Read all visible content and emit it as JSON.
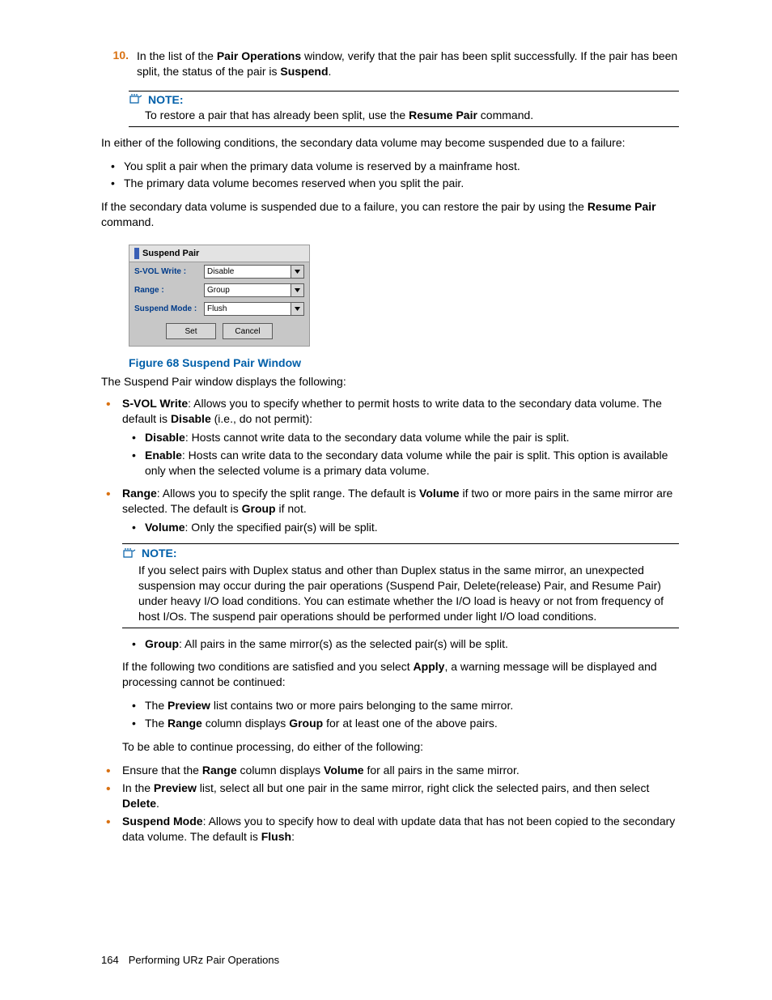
{
  "step": {
    "num": "10.",
    "text_a": "In the list of the ",
    "bold_a": "Pair Operations",
    "text_b": " window, verify that the pair has been split successfully. If the pair has been split, the status of the pair is ",
    "bold_b": "Suspend",
    "text_c": "."
  },
  "note1": {
    "label": "NOTE:",
    "body_a": "To restore a pair that has already been split, use the ",
    "body_bold": "Resume Pair",
    "body_b": " command."
  },
  "after_note1_para": "In either of the following conditions, the secondary data volume may become suspended due to a failure:",
  "after_note1_bullets": [
    "You split a pair when the primary data volume is reserved by a mainframe host.",
    "The primary data volume becomes reserved when you split the pair."
  ],
  "after_note1_para2_a": "If the secondary data volume is suspended due to a failure, you can restore the pair by using the ",
  "after_note1_para2_bold": "Resume Pair",
  "after_note1_para2_b": " command.",
  "dialog": {
    "title": "Suspend Pair",
    "rows": [
      {
        "label": "S-VOL Write :",
        "value": "Disable"
      },
      {
        "label": "Range :",
        "value": "Group"
      },
      {
        "label": "Suspend Mode :",
        "value": "Flush"
      }
    ],
    "set": "Set",
    "cancel": "Cancel"
  },
  "figure_caption": "Figure 68 Suspend Pair Window",
  "desc_intro": "The Suspend Pair window displays the following:",
  "svol": {
    "lead_bold": "S-VOL Write",
    "lead_rest": ": Allows you to specify whether to permit hosts to write data to the secondary data volume. The default is ",
    "lead_bold2": "Disable",
    "lead_rest2": " (i.e., do not permit):",
    "sub": [
      {
        "b": "Disable",
        "t": ": Hosts cannot write data to the secondary data volume while the pair is split."
      },
      {
        "b": "Enable",
        "t": ": Hosts can write data to the secondary data volume while the pair is split. This option is available only when the selected volume is a primary data volume."
      }
    ]
  },
  "range": {
    "lead_bold": "Range",
    "lead_a": ": Allows you to specify the split range. The default is ",
    "lead_b_bold": "Volume",
    "lead_b": " if two or more pairs in the same mirror are selected. The default is ",
    "lead_c_bold": "Group",
    "lead_c": " if not.",
    "sub_volume_b": "Volume",
    "sub_volume_t": ": Only the specified pair(s) will be split."
  },
  "note2": {
    "label": "NOTE:",
    "body": "If you select pairs with Duplex status and other than Duplex status in the same mirror, an unexpected suspension may occur during the pair operations (Suspend Pair, Delete(release) Pair, and Resume Pair) under heavy I/O load conditions. You can estimate whether the I/O load is heavy or not from frequency of host I/Os. The suspend pair operations should be performed under light I/O load conditions."
  },
  "group_sub_b": "Group",
  "group_sub_t": ": All pairs in the same mirror(s) as the selected pair(s) will be split.",
  "apply_para_a": "If the following two conditions are satisfied and you select ",
  "apply_para_bold": "Apply",
  "apply_para_b": ", a warning message will be displayed and processing cannot be continued:",
  "cond_bullets": [
    {
      "a": "The ",
      "b": "Preview",
      "c": " list contains two or more pairs belonging to the same mirror."
    },
    {
      "a": "The ",
      "b": "Range",
      "c": " column displays ",
      "d": "Group",
      "e": " for at least one of the above pairs."
    }
  ],
  "continue_para": "To be able to continue processing, do either of the following:",
  "continue_bullets": [
    {
      "a": "Ensure that the ",
      "b": "Range",
      "c": " column displays ",
      "d": "Volume",
      "e": " for all pairs in the same mirror."
    },
    {
      "a": "In the ",
      "b": "Preview",
      "c": " list, select all but one pair in the same mirror, right click the selected pairs, and then select ",
      "d": "Delete",
      "e": "."
    }
  ],
  "suspend_mode": {
    "b": "Suspend Mode",
    "a": ": Allows you to specify how to deal with update data that has not been copied to the secondary data volume. The default is ",
    "b2": "Flush",
    "c": ":"
  },
  "footer": {
    "page": "164",
    "title": "Performing URz Pair Operations"
  }
}
